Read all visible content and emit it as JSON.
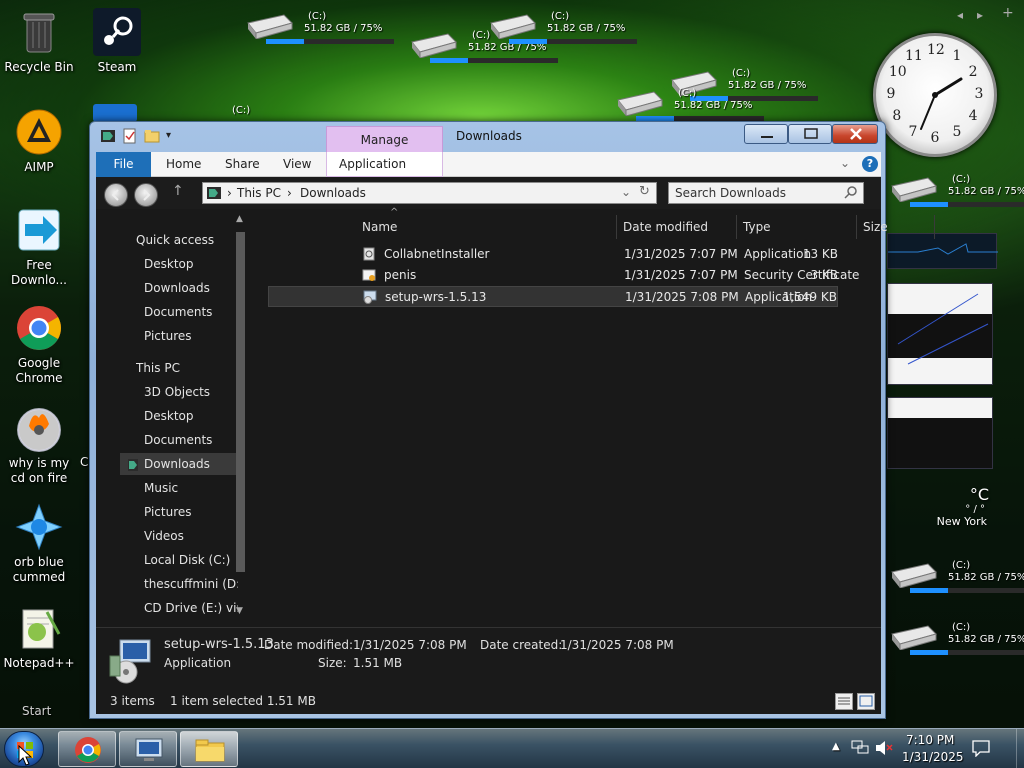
{
  "desktop": {
    "icons": [
      {
        "label": "Recycle Bin"
      },
      {
        "label": "Steam"
      },
      {
        "label": "AIMP"
      },
      {
        "label": "Free Downlo..."
      },
      {
        "label": "Google Chrome"
      },
      {
        "label": "why is my cd on fire"
      },
      {
        "label": "orb blue cummed"
      },
      {
        "label": "Notepad++"
      }
    ],
    "drive_label": "(C:)",
    "drive_usage": "51.82 GB / 75%",
    "drive_fill_percent": 75,
    "start_label": "Start",
    "partial_label": "(C:)",
    "stray_letter": "C"
  },
  "window": {
    "title": "Downloads",
    "manage_tab": "Manage",
    "ribbon_tabs": [
      "File",
      "Home",
      "Share",
      "View",
      "Application Tools"
    ],
    "address": {
      "this_pc": "This PC",
      "folder": "Downloads"
    },
    "search_placeholder": "Search Downloads",
    "nav": {
      "quick_access": "Quick access",
      "quick_items": [
        "Desktop",
        "Downloads",
        "Documents",
        "Pictures"
      ],
      "this_pc": "This PC",
      "pc_items": [
        "3D Objects",
        "Desktop",
        "Documents",
        "Downloads",
        "Music",
        "Pictures",
        "Videos",
        "Local Disk (C:)",
        "thescuffmini (D:",
        "CD Drive (E:) virt"
      ]
    },
    "columns": {
      "name": "Name",
      "date": "Date modified",
      "type": "Type",
      "size": "Size"
    },
    "files": [
      {
        "name": "CollabnetInstaller",
        "date": "1/31/2025 7:07 PM",
        "type": "Application",
        "size": "13 KB"
      },
      {
        "name": "penis",
        "date": "1/31/2025 7:07 PM",
        "type": "Security Certificate",
        "size": "3 KB"
      },
      {
        "name": "setup-wrs-1.5.13",
        "date": "1/31/2025 7:08 PM",
        "type": "Application",
        "size": "1,549 KB"
      }
    ],
    "details": {
      "name": "setup-wrs-1.5.13",
      "kind": "Application",
      "date_modified_label": "Date modified:",
      "date_modified": "1/31/2025 7:08 PM",
      "size_label": "Size:",
      "size": "1.51 MB",
      "date_created_label": "Date created:",
      "date_created": "1/31/2025 7:08 PM"
    },
    "status": {
      "count": "3 items",
      "selection": "1 item selected  1.51 MB"
    }
  },
  "gadgets": {
    "weather_temp": "°C",
    "weather_range": "° / °",
    "weather_city": "New York",
    "clock_numbers": [
      "12",
      "1",
      "2",
      "3",
      "4",
      "5",
      "6",
      "7",
      "8",
      "9",
      "10",
      "11"
    ]
  },
  "taskbar": {
    "time": "7:10 PM",
    "date": "1/31/2025"
  }
}
